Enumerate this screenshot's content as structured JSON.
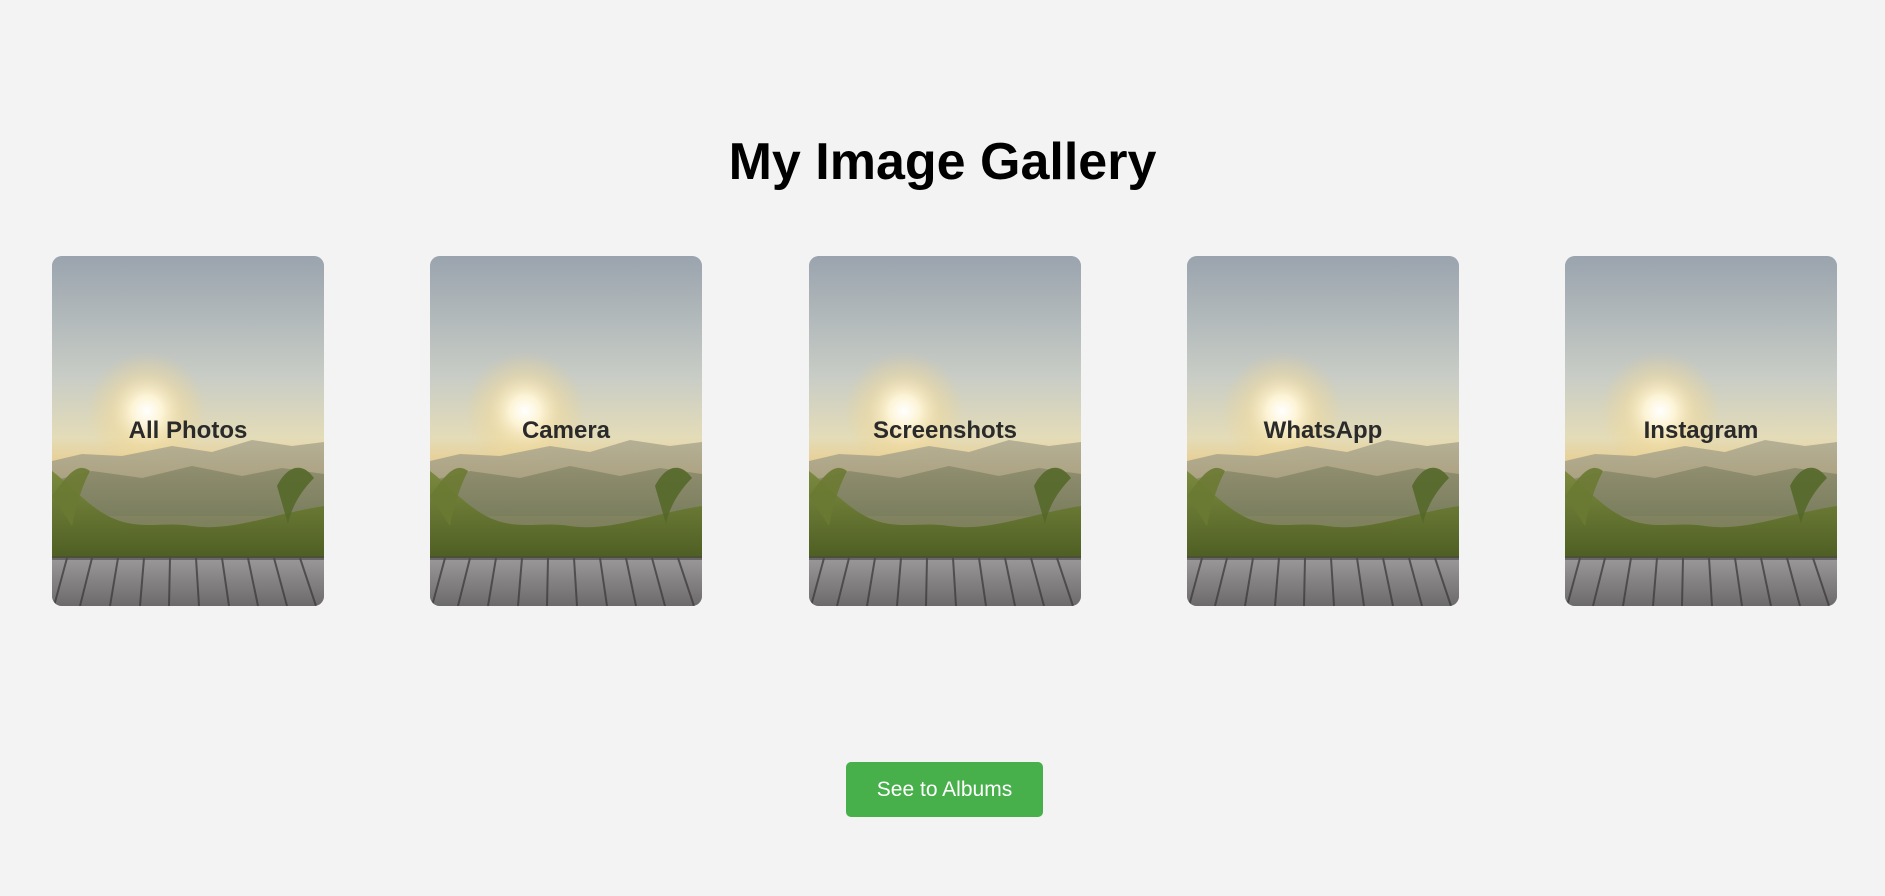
{
  "page": {
    "title": "My Image Gallery"
  },
  "gallery": {
    "cards": [
      {
        "label": "All Photos",
        "image": "sunset-mountain-wooden-deck"
      },
      {
        "label": "Camera",
        "image": "sunset-mountain-wooden-deck"
      },
      {
        "label": "Screenshots",
        "image": "sunset-mountain-wooden-deck"
      },
      {
        "label": "WhatsApp",
        "image": "sunset-mountain-wooden-deck"
      },
      {
        "label": "Instagram",
        "image": "sunset-mountain-wooden-deck"
      }
    ]
  },
  "actions": {
    "see_albums_label": "See to Albums"
  },
  "colors": {
    "background": "#f3f3f3",
    "button": "#47b04b",
    "button_text": "#ffffff",
    "title": "#000000",
    "card_label": "#2a2a2a"
  }
}
